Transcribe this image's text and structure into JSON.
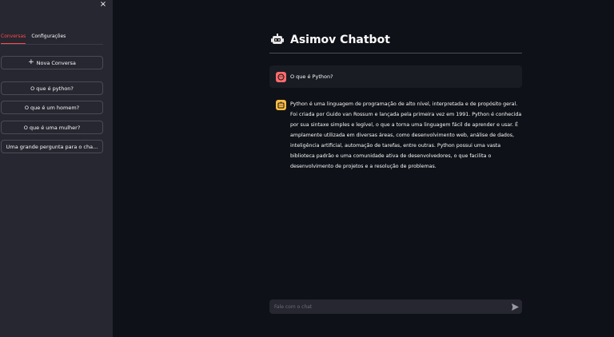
{
  "sidebar": {
    "close_label": "×",
    "tabs": [
      {
        "label": "Conversas",
        "active": true
      },
      {
        "label": "Configurações",
        "active": false
      }
    ],
    "new_chat": {
      "icon": "plus-icon",
      "label": "Nova Conversa"
    },
    "conversations": [
      "O que é python?",
      "O que é um homem?",
      "O que é uma mulher?",
      "Uma grande pergunta para o cha..."
    ]
  },
  "header": {
    "icon": "robot-icon",
    "title": "Asimov Chatbot"
  },
  "messages": {
    "user": {
      "avatar_icon": "user-face-icon",
      "text": "O que é Python?"
    },
    "bot": {
      "avatar_icon": "bot-face-icon",
      "text": "Python é uma linguagem de programação de alto nível, interpretada e de propósito geral. Foi criada por Guido van Rossum e lançada pela primeira vez em 1991. Python é conhecida por sua sintaxe simples e legível, o que a torna uma linguagem fácil de aprender e usar. É amplamente utilizada em diversas áreas, como desenvolvimento web, análise de dados, inteligência artificial, automação de tarefas, entre outras. Python possui uma vasta biblioteca padrão e uma comunidade ativa de desenvolvedores, o que facilita o desenvolvimento de projetos e a resolução de problemas."
    }
  },
  "input": {
    "placeholder": "Fale com o chat",
    "value": "",
    "send_icon": "send-icon"
  },
  "colors": {
    "background": "#0e1117",
    "sidebar": "#262730",
    "accent": "#ff4b4b",
    "user_avatar": "#ff6c6c",
    "bot_avatar": "#ffbd45"
  }
}
